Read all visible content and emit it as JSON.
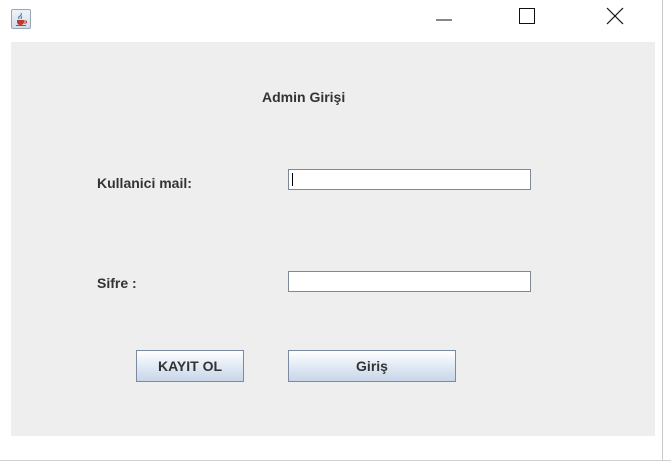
{
  "window": {
    "icon": "java-cup-icon",
    "controls": {
      "minimize": "minimize-icon",
      "maximize": "maximize-icon",
      "close": "close-icon"
    }
  },
  "form": {
    "title": "Admin Girişi",
    "mail_label": "Kullanici mail:",
    "mail_value": "",
    "password_label": "Sifre :",
    "password_value": "",
    "register_button": "KAYIT OL",
    "login_button": "Giriş"
  },
  "colors": {
    "content_background": "#eeeeee",
    "button_gradient_top": "#ffffff",
    "button_gradient_bottom": "#c8d6e8",
    "text": "#333333"
  }
}
